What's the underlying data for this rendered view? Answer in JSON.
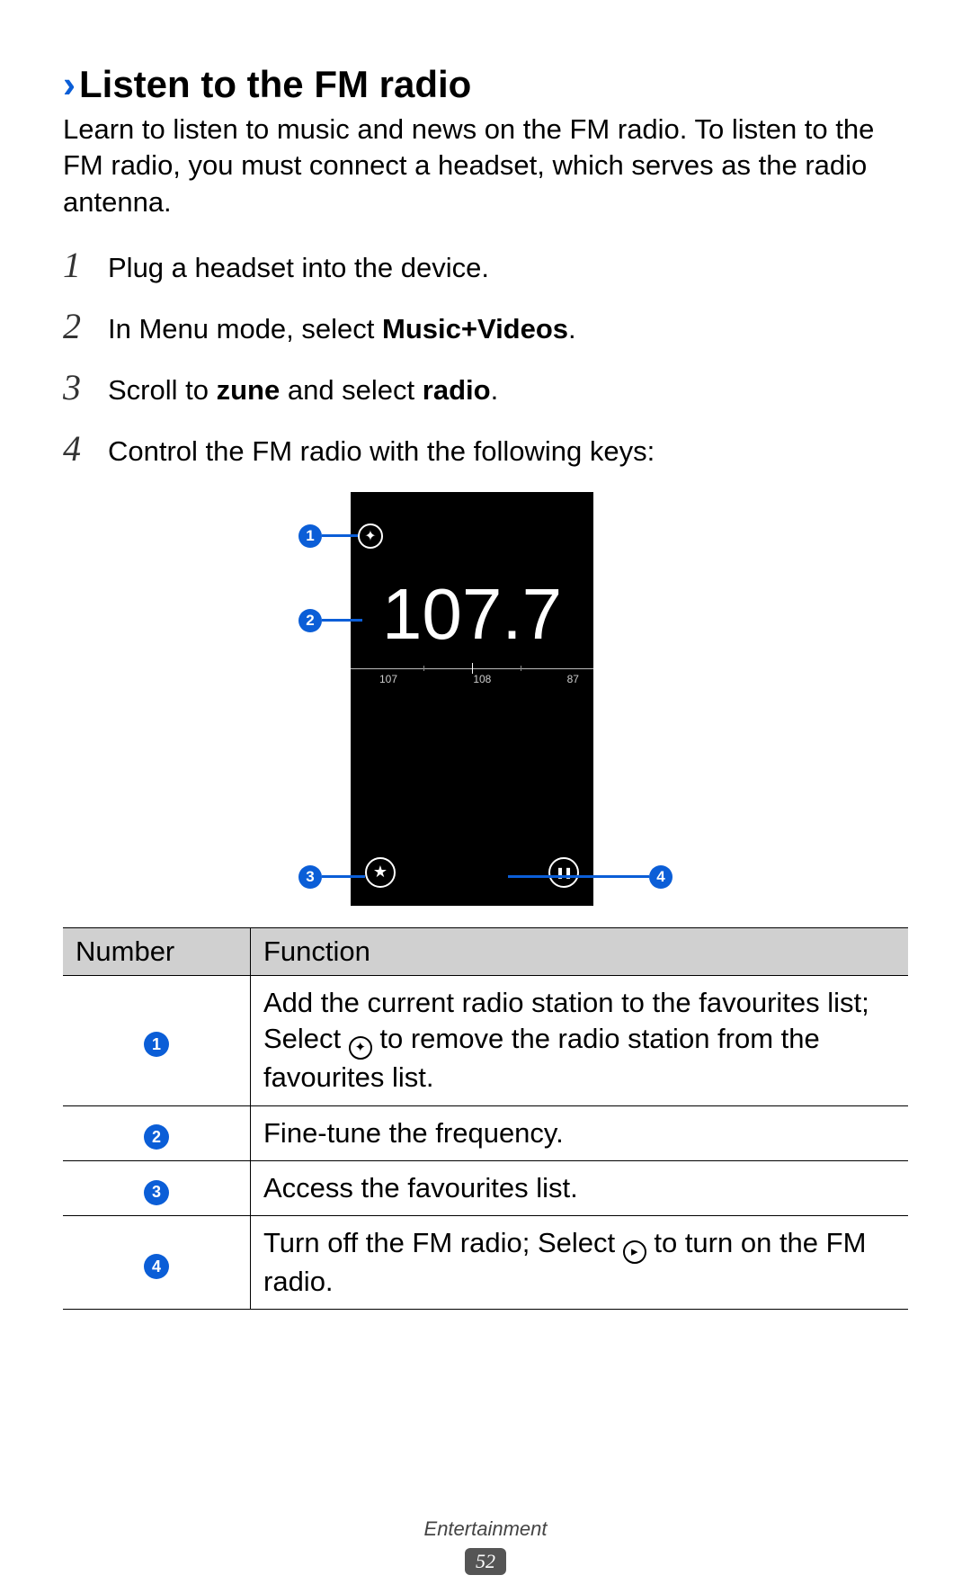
{
  "section": {
    "chevron": "›",
    "title": "Listen to the FM radio",
    "intro": "Learn to listen to music and news on the FM radio. To listen to the FM radio, you must connect a headset, which serves as the radio antenna."
  },
  "steps": [
    {
      "num": "1",
      "text": "Plug a headset into the device."
    },
    {
      "num": "2",
      "prefix": "In Menu mode, select ",
      "bold": "Music+Videos",
      "suffix": "."
    },
    {
      "num": "3",
      "prefix": "Scroll to ",
      "bold1": "zune",
      "mid": " and select ",
      "bold2": "radio",
      "suffix": "."
    },
    {
      "num": "4",
      "text": "Control the FM radio with the following keys:"
    }
  ],
  "figure": {
    "frequency": "107.7",
    "dial": {
      "left": "107",
      "center": "108",
      "right": "87"
    },
    "icons": {
      "add_star": "✦",
      "fav_star": "★",
      "pause": "❚❚"
    },
    "callouts": {
      "c1": "1",
      "c2": "2",
      "c3": "3",
      "c4": "4"
    }
  },
  "table": {
    "headers": {
      "number": "Number",
      "function": "Function"
    },
    "rows": [
      {
        "n": "1",
        "pre": "Add the current radio station to the favourites list; Select ",
        "icon": "✦",
        "post": " to remove the radio station from the favourites list."
      },
      {
        "n": "2",
        "text": "Fine-tune the frequency."
      },
      {
        "n": "3",
        "text": "Access the favourites list."
      },
      {
        "n": "4",
        "pre": "Turn off the FM radio; Select ",
        "icon": "▸",
        "post": " to turn on the FM radio."
      }
    ]
  },
  "footer": {
    "category": "Entertainment",
    "page": "52"
  }
}
